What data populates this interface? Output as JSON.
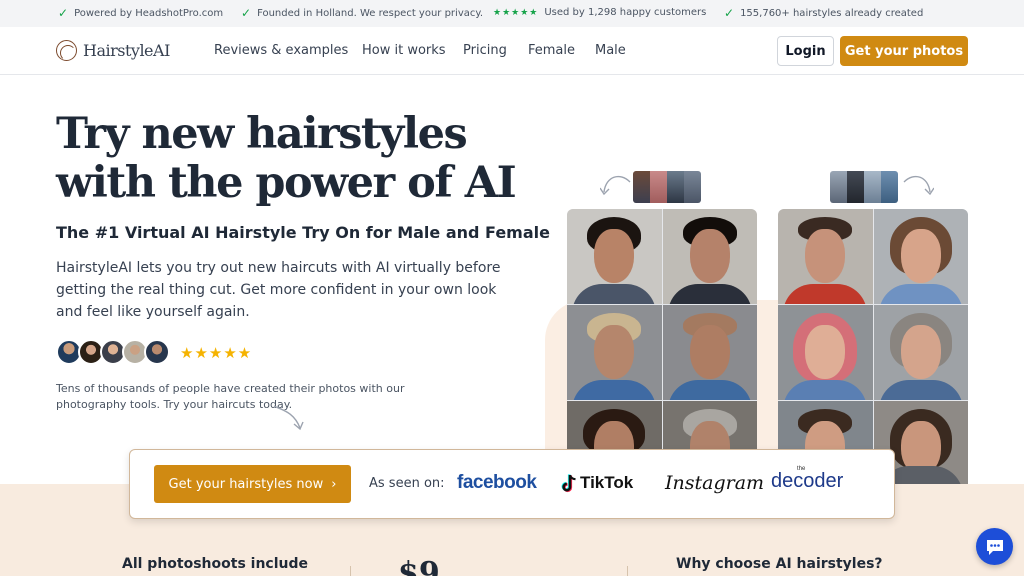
{
  "topbar": {
    "items": [
      "Powered by HeadshotPro.com",
      "Founded in Holland. We respect your privacy.",
      "Used by 1,298 happy customers",
      "155,760+ hairstyles already created"
    ],
    "rating_stars": "★★★★★"
  },
  "header": {
    "logo_text": "HairstyleAI",
    "nav": [
      "Reviews & examples",
      "How it works",
      "Pricing",
      "Female",
      "Male"
    ],
    "login_label": "Login",
    "cta_label": "Get your photos"
  },
  "hero": {
    "title_line1": "Try new hairstyles",
    "title_line2": "with the power of AI",
    "subtitle": "The #1 Virtual AI Hairstyle Try On for Male and Female",
    "body": "HairstyleAI lets you try out new haircuts with AI virtually before getting the real thing cut. Get more confident in your own look and feel like yourself again.",
    "stars": "★★★★★",
    "social_proof": "Tens of thousands of people have created their photos with our photography tools. Try your haircuts today."
  },
  "seen_on": {
    "cta_label": "Get your hairstyles now",
    "cta_chevron": "›",
    "label": "As seen on:",
    "brands": {
      "facebook": "facebook",
      "tiktok": "TikTok",
      "instagram": "Instagram",
      "decoder_prefix": "the",
      "decoder": "decoder"
    }
  },
  "bottom": {
    "left_heading": "All photoshoots include",
    "price_partial": "$9",
    "right_heading": "Why choose AI hairstyles?"
  },
  "colors": {
    "accent": "#d08a12",
    "beige": "#f8ebdf",
    "chat": "#1d4ed8"
  },
  "icons": [
    "check-icon",
    "logo-icon",
    "chevron-right-icon",
    "tiktok-icon",
    "chat-icon",
    "curved-arrow-icon"
  ]
}
